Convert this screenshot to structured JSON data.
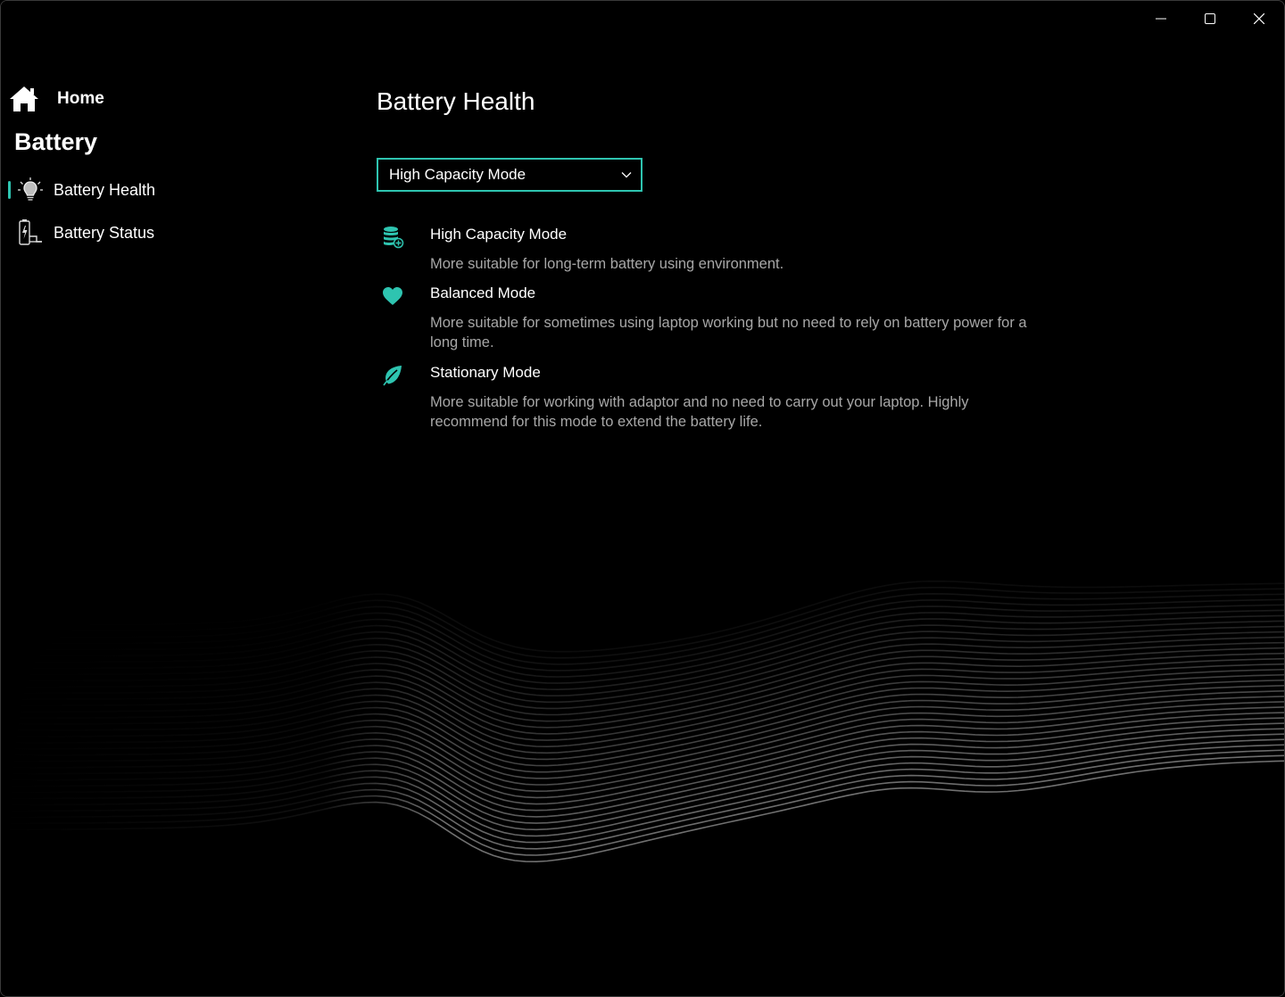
{
  "window": {
    "controls": {
      "minimize": "minimize-icon",
      "maximize": "maximize-icon",
      "close": "close-icon"
    }
  },
  "sidebar": {
    "home_label": "Home",
    "section_title": "Battery",
    "items": [
      {
        "label": "Battery Health",
        "icon": "lightbulb-icon",
        "active": true
      },
      {
        "label": "Battery Status",
        "icon": "battery-charging-icon",
        "active": false
      }
    ]
  },
  "main": {
    "title": "Battery Health",
    "mode_select": {
      "selected": "High Capacity Mode"
    },
    "modes": [
      {
        "title": "High Capacity Mode",
        "description": "More suitable for long-term battery using environment.",
        "icon": "battery-stack-icon"
      },
      {
        "title": "Balanced Mode",
        "description": "More suitable for sometimes using laptop working but no need to rely on battery power for a long time.",
        "icon": "heart-icon"
      },
      {
        "title": "Stationary Mode",
        "description": "More suitable for working with adaptor and no need to carry out your laptop. Highly recommend for this mode to extend the battery life.",
        "icon": "leaf-icon"
      }
    ]
  },
  "colors": {
    "accent": "#2ec4b0",
    "background": "#000000",
    "secondary_text": "#a7a7a7"
  }
}
